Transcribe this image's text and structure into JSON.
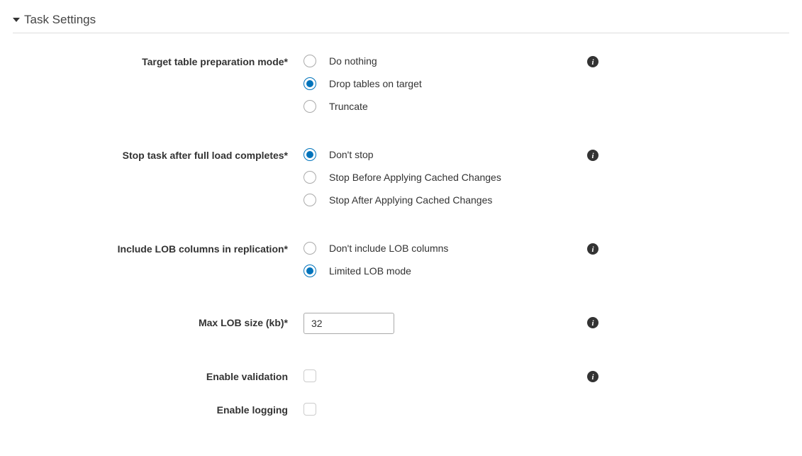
{
  "section": {
    "title": "Task Settings"
  },
  "fields": {
    "preparation_mode": {
      "label": "Target table preparation mode*",
      "options": [
        "Do nothing",
        "Drop tables on target",
        "Truncate"
      ],
      "selected": 1
    },
    "stop_task": {
      "label": "Stop task after full load completes*",
      "options": [
        "Don't stop",
        "Stop Before Applying Cached Changes",
        "Stop After Applying Cached Changes"
      ],
      "selected": 0
    },
    "lob_columns": {
      "label": "Include LOB columns in replication*",
      "options": [
        "Don't include LOB columns",
        "Limited LOB mode"
      ],
      "selected": 1
    },
    "max_lob": {
      "label": "Max LOB size (kb)*",
      "value": "32"
    },
    "enable_validation": {
      "label": "Enable validation"
    },
    "enable_logging": {
      "label": "Enable logging"
    }
  }
}
